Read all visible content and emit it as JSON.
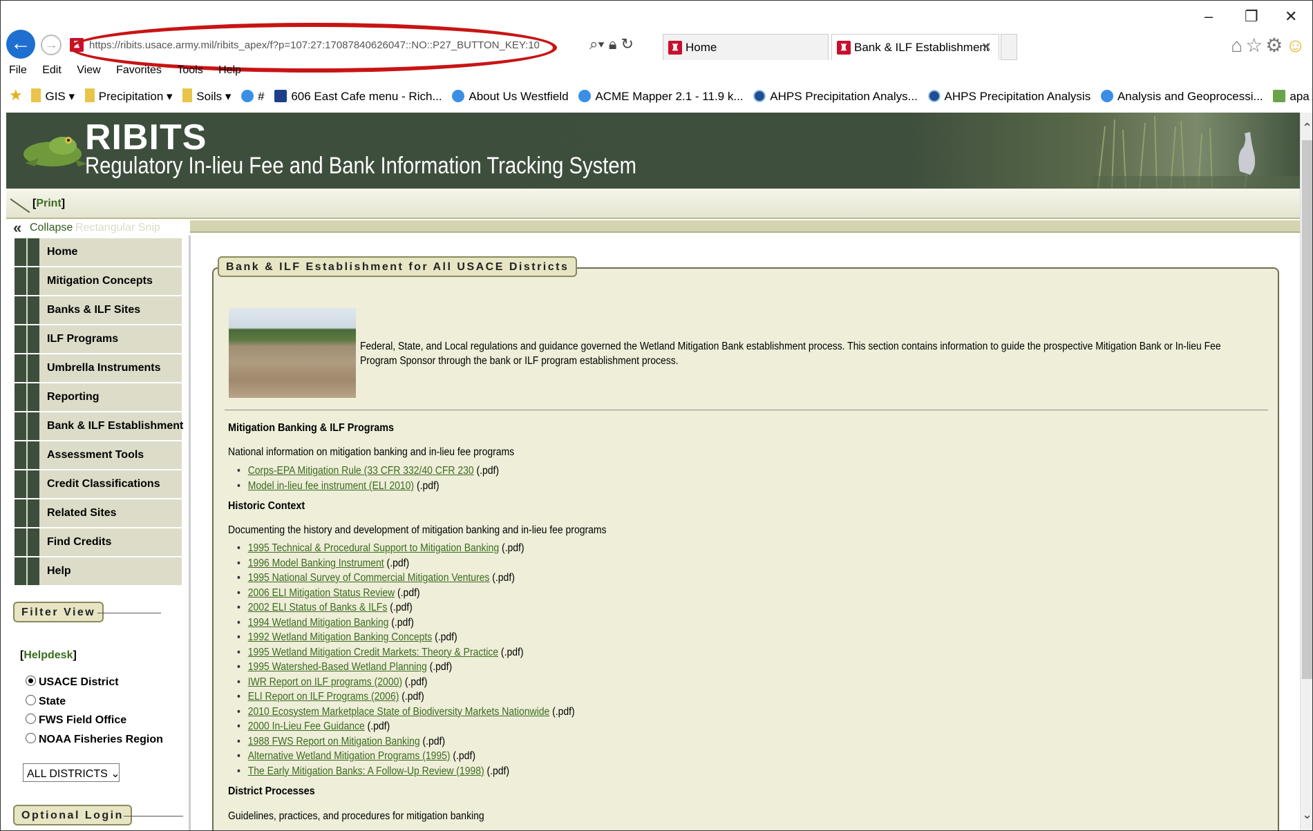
{
  "browser": {
    "url": "https://ribits.usace.army.mil/ribits_apex/f?p=107:27:17087840626047::NO::P27_BUTTON_KEY:10",
    "tabs": [
      {
        "label": "Home"
      },
      {
        "label": "Bank & ILF Establishment"
      }
    ],
    "menu": [
      "File",
      "Edit",
      "View",
      "Favorites",
      "Tools",
      "Help"
    ],
    "favorites": [
      "GIS ▾",
      "Precipitation ▾",
      "Soils ▾",
      "#",
      "606 East Cafe menu - Rich...",
      "About Us Westfield",
      "ACME Mapper 2.1 - 11.9 k...",
      "AHPS Precipitation Analys...",
      "AHPS Precipitation Analysis",
      "Analysis and Geoprocessi...",
      "apa Alabama Plant Atlas"
    ],
    "window_controls": [
      "–",
      "❐",
      "✕"
    ],
    "right_icons": "⌂☆⚙"
  },
  "header": {
    "title": "RIBITS",
    "subtitle": "Regulatory In-lieu Fee and Bank Information Tracking System"
  },
  "toolbar": {
    "print_open": "[",
    "print_label": "Print",
    "print_close": "]"
  },
  "sidebar": {
    "collapse_label": "Collapse",
    "ghost_label": "Rectangular Snip",
    "nav": [
      "Home",
      "Mitigation Concepts",
      "Banks & ILF Sites",
      "ILF Programs",
      "Umbrella Instruments",
      "Reporting",
      "Bank  & ILF Establishment",
      "Assessment Tools",
      "Credit Classifications",
      "Related Sites",
      "Find Credits",
      "Help"
    ],
    "filter_title": "Filter View",
    "helpdesk_open": "[",
    "helpdesk_label": "Helpdesk",
    "helpdesk_close": "]",
    "radios": [
      {
        "label": "USACE District",
        "selected": true
      },
      {
        "label": "State",
        "selected": false
      },
      {
        "label": "FWS Field Office",
        "selected": false
      },
      {
        "label": "NOAA Fisheries Region",
        "selected": false
      }
    ],
    "district_select": "ALL DISTRICTS",
    "login_title": "Optional Login"
  },
  "main": {
    "title": "Bank & ILF Establishment for All USACE Districts",
    "intro": "Federal, State, and Local regulations and guidance governed the Wetland Mitigation Bank establishment process. This section contains information to guide the prospective Mitigation Bank or In-lieu Fee Program Sponsor through the bank or ILF program establishment process.",
    "sections": [
      {
        "heading": "Mitigation Banking & ILF Programs",
        "description": "National information on mitigation banking and in-lieu fee programs",
        "links": [
          {
            "text": "Corps-EPA Mitigation Rule (33 CFR 332/40 CFR 230",
            "suffix": " (.pdf)"
          },
          {
            "text": "Model in-lieu fee instrument (ELI 2010)",
            "suffix": " (.pdf)"
          }
        ]
      },
      {
        "heading": "Historic Context",
        "description": "Documenting the history and development of mitigation banking and in-lieu fee programs",
        "links": [
          {
            "text": "1995 Technical & Procedural Support to Mitigation Banking",
            "suffix": " (.pdf)"
          },
          {
            "text": "1996 Model Banking Instrument",
            "suffix": " (.pdf)"
          },
          {
            "text": "1995 National Survey of Commercial Mitigation Ventures",
            "suffix": " (.pdf)"
          },
          {
            "text": "2006 ELI Mitigation Status Review",
            "suffix": " (.pdf)"
          },
          {
            "text": "2002 ELI Status of Banks & ILFs",
            "suffix": " (.pdf)"
          },
          {
            "text": "1994 Wetland Mitigation Banking",
            "suffix": " (.pdf)"
          },
          {
            "text": "1992 Wetland Mitigation Banking Concepts",
            "suffix": " (.pdf)"
          },
          {
            "text": "1995 Wetland Mitigation Credit Markets: Theory & Practice",
            "suffix": " (.pdf)"
          },
          {
            "text": "1995 Watershed-Based Wetland Planning",
            "suffix": " (.pdf)"
          },
          {
            "text": "IWR Report on ILF programs (2000)",
            "suffix": " (.pdf)"
          },
          {
            "text": "ELI Report on ILF Programs (2006)",
            "suffix": " (.pdf)"
          },
          {
            "text": "2010 Ecosystem Marketplace State of Biodiversity Markets Nationwide",
            "suffix": " (.pdf)"
          },
          {
            "text": "2000 In-Lieu Fee Guidance",
            "suffix": " (.pdf)"
          },
          {
            "text": "1988 FWS Report on Mitigation Banking",
            "suffix": " (.pdf)"
          },
          {
            "text": "Alternative Wetland Mitigation Programs (1995)",
            "suffix": " (.pdf)"
          },
          {
            "text": "The Early Mitigation Banks: A Follow-Up Review (1998)",
            "suffix": " (.pdf)"
          }
        ]
      },
      {
        "heading": "District Processes",
        "description": "Guidelines, practices, and procedures for mitigation banking",
        "links": []
      }
    ]
  }
}
